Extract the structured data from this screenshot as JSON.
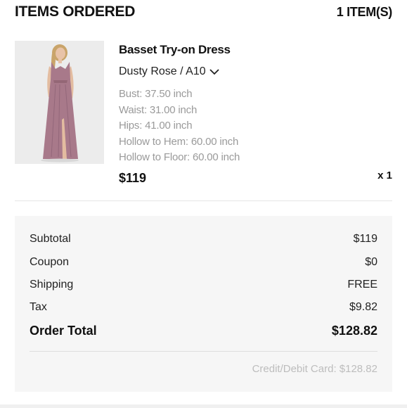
{
  "header": {
    "title": "ITEMS ORDERED",
    "count": "1 ITEM(S)"
  },
  "item": {
    "image_icon": "dress-product-image",
    "name": "Basset Try-on Dress",
    "variant": "Dusty Rose / A10",
    "measurements": [
      "Bust: 37.50 inch",
      "Waist: 31.00 inch",
      "Hips: 41.00 inch",
      "Hollow to Hem: 60.00 inch",
      "Hollow to Floor: 60.00 inch"
    ],
    "price": "$119",
    "quantity": "x 1"
  },
  "summary": {
    "rows": [
      {
        "label": "Subtotal",
        "value": "$119"
      },
      {
        "label": "Coupon",
        "value": "$0"
      },
      {
        "label": "Shipping",
        "value": "FREE"
      },
      {
        "label": "Tax",
        "value": "$9.82"
      }
    ],
    "total_label": "Order Total",
    "total_value": "$128.82",
    "payment": "Credit/Debit Card: $128.82"
  },
  "colors": {
    "dress": "#a8798a",
    "muted_text": "#9a9a9a",
    "panel_bg": "#f6f6f6"
  }
}
